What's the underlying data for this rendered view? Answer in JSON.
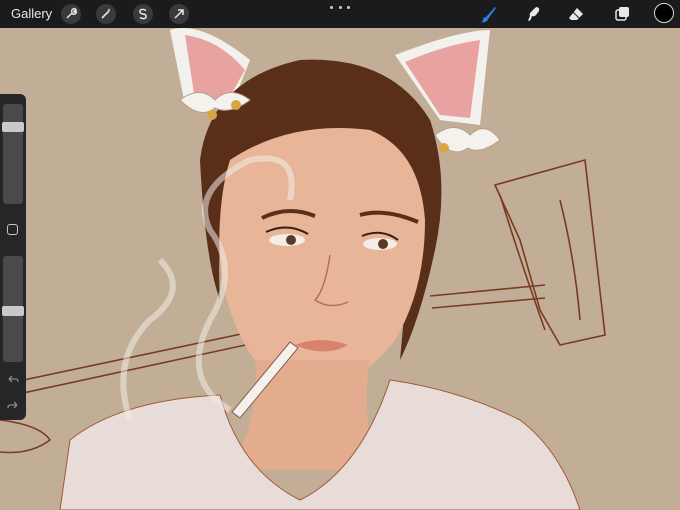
{
  "toolbar": {
    "gallery_label": "Gallery",
    "left_tools": [
      {
        "name": "wrench-icon"
      },
      {
        "name": "magic-wand-icon"
      },
      {
        "name": "selection-s-icon"
      },
      {
        "name": "transform-arrow-icon"
      }
    ],
    "more_icon": "more-dots-icon",
    "right_tools": [
      {
        "name": "brush-icon",
        "active": true
      },
      {
        "name": "smudge-icon"
      },
      {
        "name": "eraser-icon"
      },
      {
        "name": "layers-icon"
      }
    ],
    "current_color": "#000000",
    "active_color": "#2b7fe0"
  },
  "sidebar": {
    "brush_size": 0.8,
    "opacity": 0.48,
    "modify_icon": "square-icon",
    "undo_icon": "undo-arrow-icon",
    "redo_icon": "redo-arrow-icon"
  },
  "canvas": {
    "background_color": "#c2ae96",
    "skin_color": "#e8b598",
    "hair_color": "#5a2f1a",
    "ear_color": "#e8a2a0",
    "shirt_color": "#e8dcd8"
  }
}
